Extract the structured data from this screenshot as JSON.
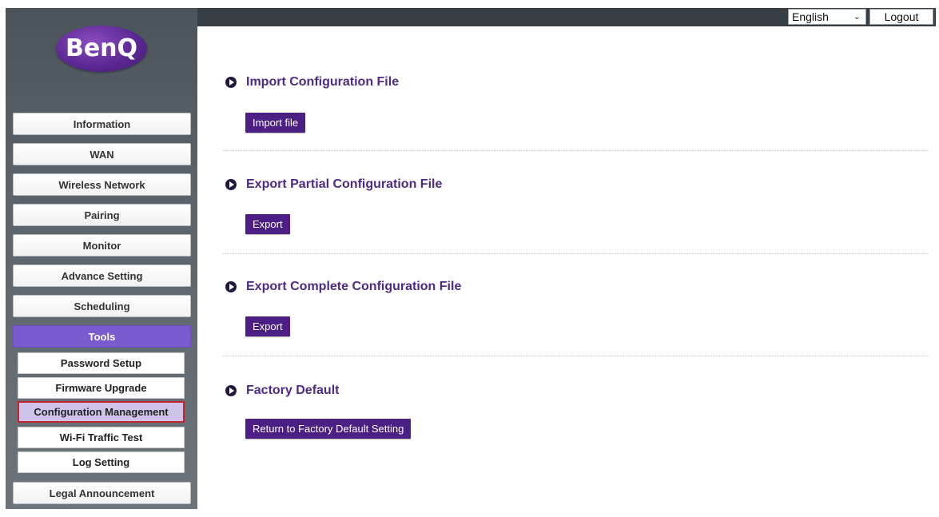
{
  "header": {
    "language": "English",
    "logout_label": "Logout"
  },
  "brand": {
    "logo_text": "BenQ",
    "logo_color": "#5d2994"
  },
  "sidebar": {
    "items": [
      {
        "label": "Information"
      },
      {
        "label": "WAN"
      },
      {
        "label": "Wireless Network"
      },
      {
        "label": "Pairing"
      },
      {
        "label": "Monitor"
      },
      {
        "label": "Advance Setting"
      },
      {
        "label": "Scheduling"
      },
      {
        "label": "Tools",
        "active": true
      },
      {
        "label": "Legal Announcement"
      }
    ],
    "tools_submenu": [
      {
        "label": "Password Setup"
      },
      {
        "label": "Firmware Upgrade"
      },
      {
        "label": "Configuration Management",
        "selected": true
      },
      {
        "label": "Wi-Fi Traffic Test"
      },
      {
        "label": "Log Setting"
      }
    ]
  },
  "main": {
    "sections": [
      {
        "title": "Import Configuration File",
        "button": "Import file"
      },
      {
        "title": "Export Partial Configuration File",
        "button": "Export"
      },
      {
        "title": "Export Complete Configuration File",
        "button": "Export"
      },
      {
        "title": "Factory Default",
        "button": "Return to Factory Default Setting"
      }
    ]
  },
  "colors": {
    "accent_purple": "#4b1f83",
    "title_purple": "#4e2a86",
    "active_nav": "#7a5bd0",
    "selected_submenu": "#cfc3ea",
    "selected_border": "#c0282d",
    "topbar": "#373f45"
  }
}
